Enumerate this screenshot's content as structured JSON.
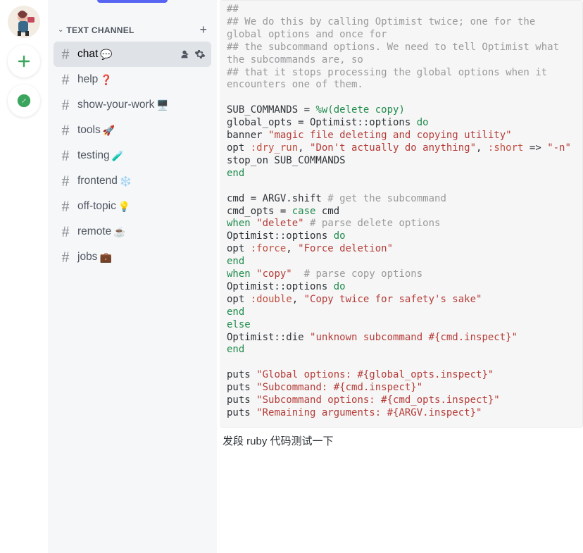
{
  "rail": {
    "plus_glyph": "+",
    "compass_glyph": "✦"
  },
  "sidebar": {
    "category_label": "TEXT CHANNEL",
    "add_glyph": "+",
    "channels": [
      {
        "name": "chat",
        "emoji": "💬",
        "selected": true
      },
      {
        "name": "help",
        "emoji": "❓",
        "selected": false
      },
      {
        "name": "show-your-work",
        "emoji": "🖥️",
        "selected": false
      },
      {
        "name": "tools",
        "emoji": "🚀",
        "selected": false
      },
      {
        "name": "testing",
        "emoji": "🧪",
        "selected": false
      },
      {
        "name": "frontend",
        "emoji": "❄️",
        "selected": false
      },
      {
        "name": "off-topic",
        "emoji": "💡",
        "selected": false
      },
      {
        "name": "remote",
        "emoji": "☕",
        "selected": false
      },
      {
        "name": "jobs",
        "emoji": "💼",
        "selected": false
      }
    ]
  },
  "code": {
    "l1": "##",
    "l2": "## We do this by calling Optimist twice; one for the global options and once for",
    "l3": "## the subcommand options. We need to tell Optimist what the subcommands are, so",
    "l4": "## that it stops processing the global options when it encounters one of them.",
    "blank": " ",
    "l5a": "SUB_COMMANDS = ",
    "l5b": "%w(delete copy)",
    "l6a": "global_opts = Optimist::options ",
    "do": "do",
    "l7a": "banner ",
    "l7b": "\"magic file deleting and copying utility\"",
    "l8a": "opt ",
    "l8b": ":dry_run",
    "l8c": ", ",
    "l8d": "\"Don't actually do anything\"",
    "l8e": ", ",
    "l8f": ":short",
    "l8g": " => ",
    "l8h": "\"-n\"",
    "l9": "stop_on SUB_COMMANDS",
    "end": "end",
    "l10a": "cmd = ARGV.shift ",
    "l10b": "# get the subcommand",
    "l11a": "cmd_opts = ",
    "case": "case",
    "l11b": " cmd",
    "when": "when",
    "l12a": " ",
    "l12b": "\"delete\"",
    "l12c": " ",
    "l12d": "# parse delete options",
    "l13a": "Optimist::options ",
    "l14a": "opt ",
    "l14b": ":force",
    "l14c": ", ",
    "l14d": "\"Force deletion\"",
    "l16b": "\"copy\"",
    "l16c": "  ",
    "l16d": "# parse copy options",
    "l18b": ":double",
    "l18d": "\"Copy twice for safety's sake\"",
    "else": "else",
    "l20a": "Optimist::die ",
    "l20b": "\"unknown subcommand #{cmd.inspect}\"",
    "l22a": "puts ",
    "l22b": "\"Global options: #{global_opts.inspect}\"",
    "l23b": "\"Subcommand: #{cmd.inspect}\"",
    "l24b": "\"Subcommand options: #{cmd_opts.inspect}\"",
    "l25b": "\"Remaining arguments: #{ARGV.inspect}\""
  },
  "caption": "发段 ruby 代码测试一下"
}
